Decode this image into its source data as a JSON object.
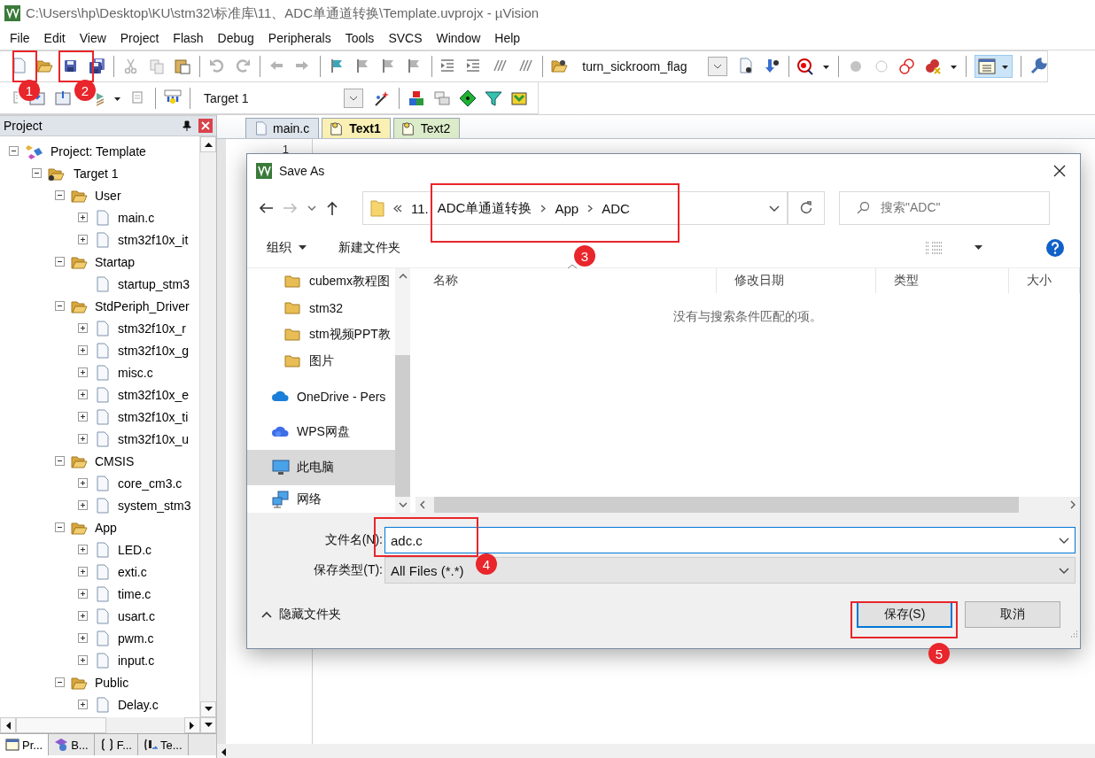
{
  "window": {
    "title": "C:\\Users\\hp\\Desktop\\KU\\stm32\\标准库\\11、ADC单通道转换\\Template.uvprojx - µVision"
  },
  "menu": [
    "File",
    "Edit",
    "View",
    "Project",
    "Flash",
    "Debug",
    "Peripherals",
    "Tools",
    "SVCS",
    "Window",
    "Help"
  ],
  "toolbar": {
    "find_combo": "turn_sickroom_flag",
    "target_combo": "Target 1"
  },
  "project_panel": {
    "title": "Project",
    "tree": [
      {
        "kind": "project",
        "label": "Project: Template",
        "expanded": true,
        "children": [
          {
            "kind": "target",
            "label": "Target 1",
            "expanded": true,
            "children": [
              {
                "kind": "folder",
                "label": "User",
                "expanded": true,
                "children": [
                  {
                    "kind": "file",
                    "label": "main.c",
                    "expanded": false
                  },
                  {
                    "kind": "file",
                    "label": "stm32f10x_it",
                    "expanded": false
                  }
                ]
              },
              {
                "kind": "folder",
                "label": "Startap",
                "expanded": true,
                "children": [
                  {
                    "kind": "file",
                    "label": "startup_stm3"
                  }
                ]
              },
              {
                "kind": "folder",
                "label": "StdPeriph_Driver",
                "expanded": true,
                "children": [
                  {
                    "kind": "file",
                    "label": "stm32f10x_r",
                    "expanded": false
                  },
                  {
                    "kind": "file",
                    "label": "stm32f10x_g",
                    "expanded": false
                  },
                  {
                    "kind": "file",
                    "label": "misc.c",
                    "expanded": false
                  },
                  {
                    "kind": "file",
                    "label": "stm32f10x_e",
                    "expanded": false
                  },
                  {
                    "kind": "file",
                    "label": "stm32f10x_ti",
                    "expanded": false
                  },
                  {
                    "kind": "file",
                    "label": "stm32f10x_u",
                    "expanded": false
                  }
                ]
              },
              {
                "kind": "folder",
                "label": "CMSIS",
                "expanded": true,
                "children": [
                  {
                    "kind": "file",
                    "label": "core_cm3.c",
                    "expanded": false
                  },
                  {
                    "kind": "file",
                    "label": "system_stm3",
                    "expanded": false
                  }
                ]
              },
              {
                "kind": "folder",
                "label": "App",
                "expanded": true,
                "children": [
                  {
                    "kind": "file",
                    "label": "LED.c",
                    "expanded": false
                  },
                  {
                    "kind": "file",
                    "label": "exti.c",
                    "expanded": false
                  },
                  {
                    "kind": "file",
                    "label": "time.c",
                    "expanded": false
                  },
                  {
                    "kind": "file",
                    "label": "usart.c",
                    "expanded": false
                  },
                  {
                    "kind": "file",
                    "label": "pwm.c",
                    "expanded": false
                  },
                  {
                    "kind": "file",
                    "label": "input.c",
                    "expanded": false
                  }
                ]
              },
              {
                "kind": "folder",
                "label": "Public",
                "expanded": true,
                "children": [
                  {
                    "kind": "file",
                    "label": "Delay.c",
                    "expanded": false
                  }
                ]
              }
            ]
          }
        ]
      }
    ],
    "bottom_tabs": [
      {
        "label": "Pr...",
        "selected": true
      },
      {
        "label": "B...",
        "selected": false
      },
      {
        "label": "F...",
        "selected": false
      },
      {
        "label": "Te...",
        "selected": false
      }
    ]
  },
  "editor": {
    "tabs": [
      {
        "label": "main.c",
        "selected": false,
        "color": "#dfe5ec"
      },
      {
        "label": "Text1",
        "selected": true,
        "color": "#fbf0b4"
      },
      {
        "label": "Text2",
        "selected": false,
        "color": "#dcebc9"
      }
    ],
    "line_numbers": [
      "1"
    ]
  },
  "dialog": {
    "title": "Save As",
    "address": [
      "11.",
      "ADC单通道转换",
      "App",
      "ADC"
    ],
    "search_placeholder": "搜索\"ADC\"",
    "organize": "组织",
    "new_folder": "新建文件夹",
    "nav_items": [
      {
        "kind": "folder",
        "label": "cubemx教程图",
        "selected": false
      },
      {
        "kind": "folder",
        "label": "stm32",
        "selected": false
      },
      {
        "kind": "folder",
        "label": "stm视频PPT教",
        "selected": false
      },
      {
        "kind": "folder",
        "label": "图片",
        "selected": false
      },
      {
        "kind": "cloud",
        "label": "OneDrive - Pers",
        "selected": false
      },
      {
        "kind": "wps",
        "label": "WPS网盘",
        "selected": false
      },
      {
        "kind": "pc",
        "label": "此电脑",
        "selected": true
      },
      {
        "kind": "network",
        "label": "网络",
        "selected": false
      }
    ],
    "columns": [
      "名称",
      "修改日期",
      "类型",
      "大小"
    ],
    "empty_message": "没有与搜索条件匹配的项。",
    "file_name_label": "文件名(N):",
    "file_name": "adc.c",
    "file_type_label": "保存类型(T):",
    "file_type": "All Files (*.*)",
    "hide_folders": "隐藏文件夹",
    "save_button": "保存(S)",
    "cancel_button": "取消"
  },
  "annotations": [
    {
      "number": "1"
    },
    {
      "number": "2"
    },
    {
      "number": "3"
    },
    {
      "number": "4"
    },
    {
      "number": "5"
    }
  ]
}
